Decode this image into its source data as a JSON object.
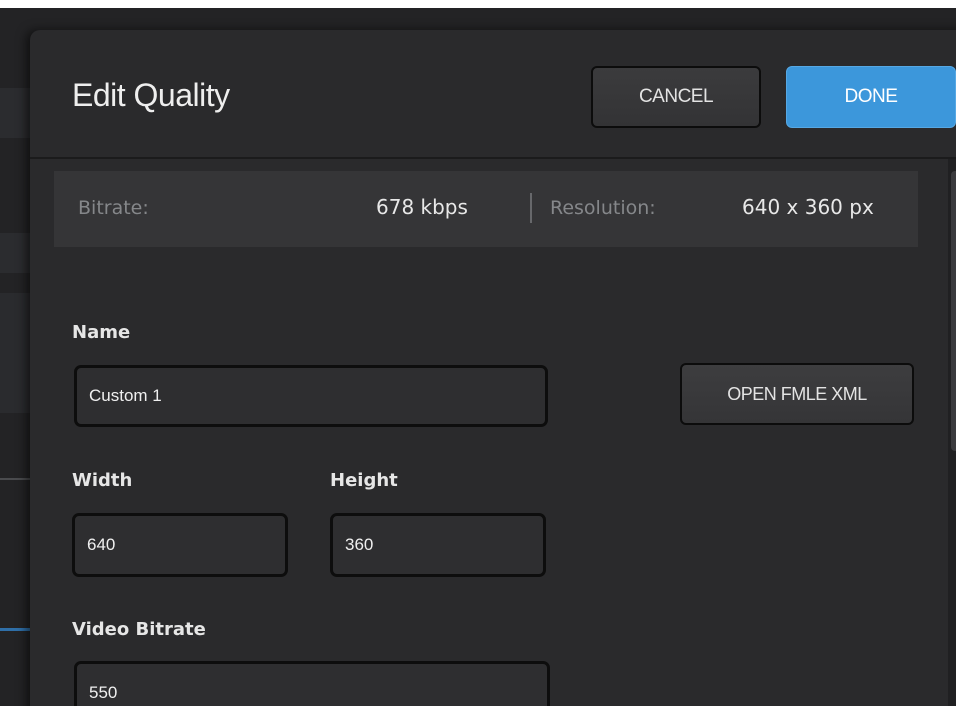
{
  "dialog": {
    "title": "Edit Quality",
    "cancel_label": "CANCEL",
    "done_label": "DONE"
  },
  "info": {
    "bitrate_label": "Bitrate:",
    "bitrate_value": "678 kbps",
    "resolution_label": "Resolution:",
    "resolution_value": "640 x 360 px"
  },
  "form": {
    "name_label": "Name",
    "name_value": "Custom 1",
    "open_fmle_label": "OPEN FMLE XML",
    "width_label": "Width",
    "width_value": "640",
    "height_label": "Height",
    "height_value": "360",
    "video_bitrate_label": "Video Bitrate",
    "video_bitrate_value": "550"
  },
  "colors": {
    "accent": "#3c97db",
    "dialog_bg": "#2a2a2c",
    "info_bar_bg": "#353537"
  }
}
